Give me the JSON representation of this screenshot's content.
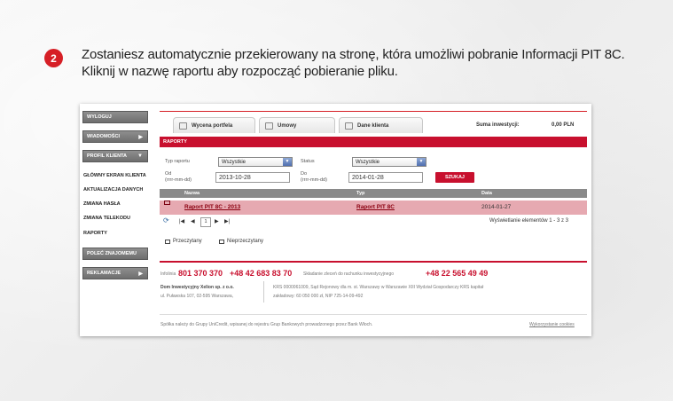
{
  "step": {
    "number": "2"
  },
  "instruction": {
    "line1": "Zostaniesz automatycznie przekierowany na stronę, która umożliwi pobranie Informacji PIT 8C.",
    "line2": "Kliknij w nazwę raportu aby rozpocząć pobieranie pliku."
  },
  "sidebar": {
    "wyloguj": "WYLOGUJ",
    "wiadomosci": "WIADOMOŚCI",
    "profil": "PROFIL KLIENTA",
    "links": [
      "GŁÓWNY EKRAN KLIENTA",
      "AKTUALIZACJA DANYCH",
      "ZMIANA HASŁA",
      "ZMIANA TELEKODU",
      "RAPORTY"
    ],
    "polec": "POLEĆ ZNAJOMEMU",
    "reklamacje": "REKLAMACJE"
  },
  "tabs": [
    "Wycena portfela",
    "Umowy",
    "Dane klienta"
  ],
  "summary": {
    "label": "Suma inwestycji:",
    "value": "0,00 PLN"
  },
  "section_title": "RAPORTY",
  "filters": {
    "typ_label": "Typ raportu",
    "typ_value": "Wszystkie",
    "status_label": "Status",
    "status_value": "Wszystkie",
    "od_label": "Od",
    "od_hint": "(rrrr-mm-dd)",
    "od_value": "2013-10-28",
    "do_label": "Do",
    "do_hint": "(rrrr-mm-dd)",
    "do_value": "2014-01-28",
    "search_button": "SZUKAJ"
  },
  "table": {
    "columns": [
      "Nazwa",
      "Typ",
      "Data"
    ],
    "rows": [
      {
        "name": "Raport PIT 8C - 2013",
        "type": "Raport PIT 8C",
        "date": "2014-01-27"
      }
    ]
  },
  "pager": {
    "page": "1",
    "display": "Wyświetlanie elementów 1 - 3 z 3"
  },
  "legend": {
    "read": "Przeczytany",
    "unread": "Nieprzeczytany"
  },
  "footer": {
    "infolinia_label": "Infolinia",
    "infolinia_num1": "801 370 370",
    "infolinia_num2": "+48 42 683 83 70",
    "zlecenia_label": "Składanie zleceń do rachunku inwestycyjnego",
    "zlecenia_num": "+48 22 565 49 49",
    "company": "Dom Inwestycyjny Xelion sp. z o.o.",
    "address": "ul. Puławska 107, 02-595 Warszawa,",
    "krs": "KRS 0000061009, Sąd Rejonowy dla m. st. Warszawy w Warszawie XIII Wydział Gospodarczy KRS kapitał",
    "capital": "zakładowy: 60 050 000 zł, NIP 725-14-09-492",
    "group": "Spółka należy do Grupy UniCredit, wpisanej do rejestru Grup Bankowych prowadzonego przez Bank Włoch.",
    "cookies": "Wykorzystanie cookies"
  }
}
